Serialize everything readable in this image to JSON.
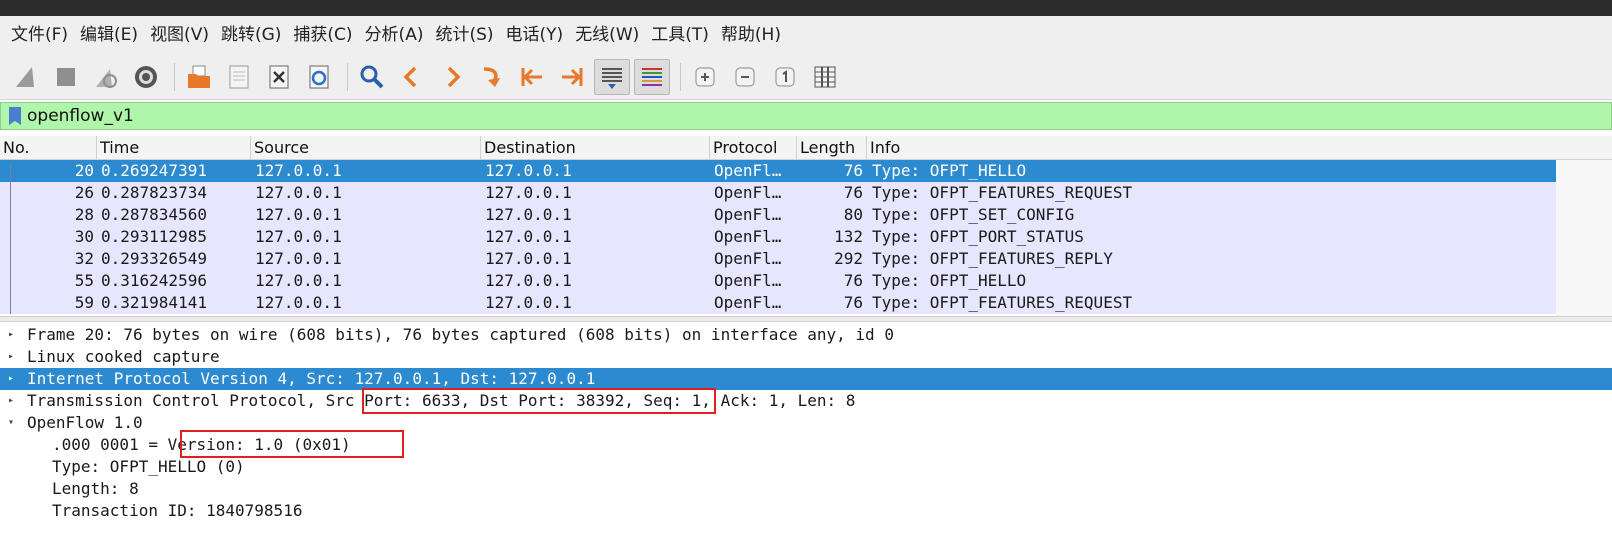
{
  "window": {
    "title": ""
  },
  "menu": [
    "文件(F)",
    "编辑(E)",
    "视图(V)",
    "跳转(G)",
    "捕获(C)",
    "分析(A)",
    "统计(S)",
    "电话(Y)",
    "无线(W)",
    "工具(T)",
    "帮助(H)"
  ],
  "toolbar": {
    "icons": [
      "shark-fin-icon",
      "stop-icon",
      "restart-icon",
      "options-gear-icon",
      "open-folder-icon",
      "file-icon",
      "close-file-icon",
      "reload-icon",
      "find-icon",
      "back-icon",
      "forward-icon",
      "goto-icon",
      "first-packet-icon",
      "last-packet-icon",
      "autoscroll-icon",
      "colorize-icon",
      "zoom-in-icon",
      "zoom-out-icon",
      "zoom-reset-icon",
      "resize-columns-icon"
    ]
  },
  "filter": {
    "value": "openflow_v1"
  },
  "columns": [
    "No.",
    "Time",
    "Source",
    "Destination",
    "Protocol",
    "Length",
    "Info"
  ],
  "packets": [
    {
      "no": "20",
      "time": "0.269247391",
      "src": "127.0.0.1",
      "dst": "127.0.0.1",
      "proto": "OpenFl…",
      "len": "76",
      "info": "Type: OFPT_HELLO",
      "selected": true
    },
    {
      "no": "26",
      "time": "0.287823734",
      "src": "127.0.0.1",
      "dst": "127.0.0.1",
      "proto": "OpenFl…",
      "len": "76",
      "info": "Type: OFPT_FEATURES_REQUEST"
    },
    {
      "no": "28",
      "time": "0.287834560",
      "src": "127.0.0.1",
      "dst": "127.0.0.1",
      "proto": "OpenFl…",
      "len": "80",
      "info": "Type: OFPT_SET_CONFIG"
    },
    {
      "no": "30",
      "time": "0.293112985",
      "src": "127.0.0.1",
      "dst": "127.0.0.1",
      "proto": "OpenFl…",
      "len": "132",
      "info": "Type: OFPT_PORT_STATUS"
    },
    {
      "no": "32",
      "time": "0.293326549",
      "src": "127.0.0.1",
      "dst": "127.0.0.1",
      "proto": "OpenFl…",
      "len": "292",
      "info": "Type: OFPT_FEATURES_REPLY"
    },
    {
      "no": "55",
      "time": "0.316242596",
      "src": "127.0.0.1",
      "dst": "127.0.0.1",
      "proto": "OpenFl…",
      "len": "76",
      "info": "Type: OFPT_HELLO"
    },
    {
      "no": "59",
      "time": "0.321984141",
      "src": "127.0.0.1",
      "dst": "127.0.0.1",
      "proto": "OpenFl…",
      "len": "76",
      "info": "Type: OFPT_FEATURES_REQUEST"
    }
  ],
  "details": {
    "frame": "Frame 20: 76 bytes on wire (608 bits), 76 bytes captured (608 bits) on interface any, id 0",
    "linux": "Linux cooked capture",
    "ip": "Internet Protocol Version 4, Src: 127.0.0.1, Dst: 127.0.0.1",
    "tcp": "Transmission Control Protocol, Src Port: 6633, Dst Port: 38392, Seq: 1, Ack: 1, Len: 8",
    "openflow": "OpenFlow 1.0",
    "version": ".000 0001 = Version: 1.0 (0x01)",
    "type": "Type: OFPT_HELLO (0)",
    "length": "Length: 8",
    "xid": "Transaction ID: 1840798516"
  },
  "colors": {
    "selection": "#2b8ad0",
    "row_bg": "#e7e6ff",
    "filter_bg": "#aff5aa",
    "highlight_box": "#e02020"
  }
}
